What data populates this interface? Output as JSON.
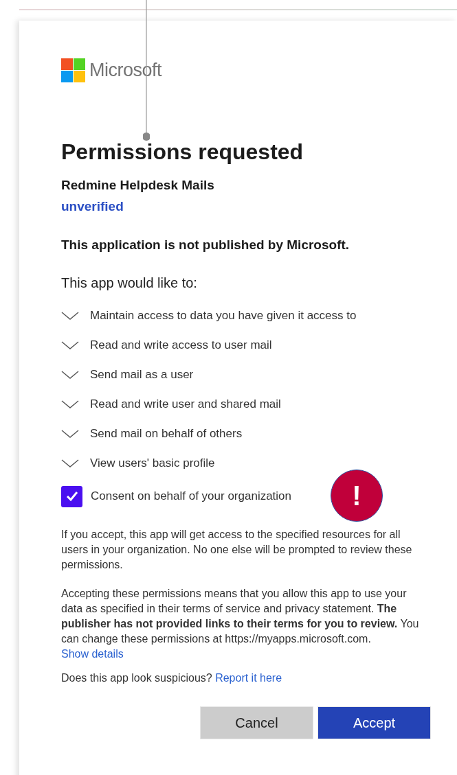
{
  "logo": {
    "text": "Microsoft"
  },
  "title": "Permissions requested",
  "app": {
    "name": "Redmine Helpdesk Mails",
    "status": "unverified"
  },
  "publisher_notice": "This application is not published by Microsoft.",
  "intro": "This app would like to:",
  "permissions": [
    {
      "label": "Maintain access to data you have given it access to",
      "expanded": false
    },
    {
      "label": "Read and write access to user mail",
      "expanded": false
    },
    {
      "label": "Send mail as a user",
      "expanded": false
    },
    {
      "label": "Read and write user and shared mail",
      "expanded": false
    },
    {
      "label": "Send mail on behalf of others",
      "expanded": false
    },
    {
      "label": "View users' basic profile",
      "expanded": false
    }
  ],
  "consent": {
    "label": "Consent on behalf of your organization",
    "checked": true
  },
  "warning_badge": "!",
  "org_notice": "If you accept, this app will get access to the specified resources for all users in your organization. No one else will be prompted to review these permissions.",
  "terms_notice": {
    "text": "Accepting these permissions means that you allow this app to use your data as specified in their terms of service and privacy statement. **The publisher has not provided links to their terms for you to review.** You can change these permissions at https://myapps.microsoft.com.",
    "link": "Show details"
  },
  "report": {
    "text": "Does this app look suspicious?",
    "link": "Report it here"
  },
  "buttons": [
    {
      "label": "Cancel",
      "kind": "secondary"
    },
    {
      "label": "Accept",
      "kind": "primary"
    }
  ]
}
